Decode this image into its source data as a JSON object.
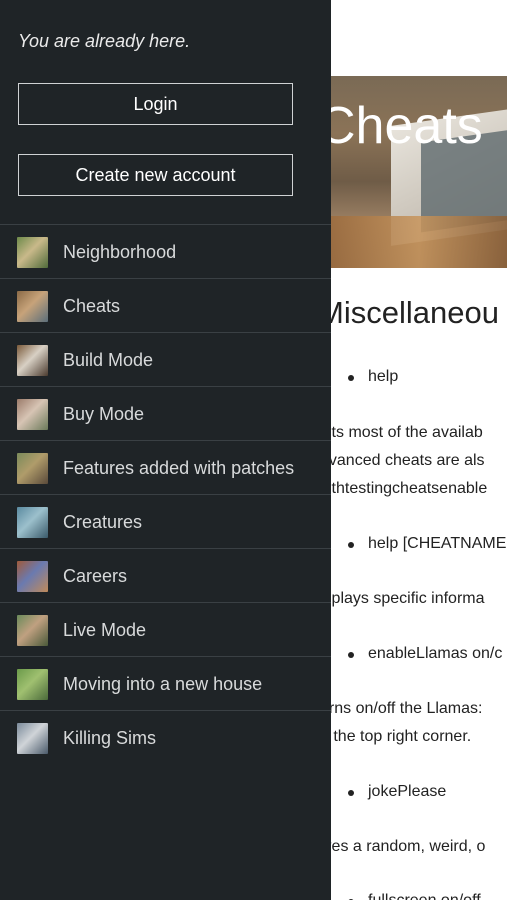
{
  "page": {
    "hero_title": "Cheats",
    "section_heading": "Miscellaneou",
    "bullets": [
      "help",
      "help [CHEATNAME",
      "enableLlamas on/c",
      "jokePlease",
      "fullscreen on/off"
    ],
    "paragraphs": [
      "ists most of the availab",
      "dvanced cheats are als",
      "vithtestingcheatsenable",
      "isplays specific informa",
      "urns on/off the Llamas: ",
      "n the top right corner.",
      "ives a random, weird, o"
    ]
  },
  "drawer": {
    "status_text": "You are already here.",
    "login_label": "Login",
    "create_account_label": "Create new account",
    "menu": [
      {
        "label": "Neighborhood",
        "icon": "neighborhood-thumbnail-icon",
        "colors": [
          "#6d8a4a",
          "#c9b98a",
          "#4f6b3a"
        ]
      },
      {
        "label": "Cheats",
        "icon": "cheats-thumbnail-icon",
        "colors": [
          "#8a6a46",
          "#c7a37a",
          "#5b6e7a"
        ]
      },
      {
        "label": "Build Mode",
        "icon": "build-mode-thumbnail-icon",
        "colors": [
          "#7a5a3a",
          "#d8d0c4",
          "#4a3a2e"
        ]
      },
      {
        "label": "Buy Mode",
        "icon": "buy-mode-thumbnail-icon",
        "colors": [
          "#9b7b6a",
          "#d7c4b4",
          "#6b7a5a"
        ]
      },
      {
        "label": "Features added with patches",
        "icon": "patches-thumbnail-icon",
        "colors": [
          "#7a8a5a",
          "#b09c6a",
          "#5a4a3a"
        ]
      },
      {
        "label": "Creatures",
        "icon": "creatures-thumbnail-icon",
        "colors": [
          "#5a8aa0",
          "#9cc0cc",
          "#3a5a6a"
        ]
      },
      {
        "label": "Careers",
        "icon": "careers-thumbnail-icon",
        "colors": [
          "#a05a3a",
          "#6a7ab0",
          "#c08a5a"
        ]
      },
      {
        "label": "Live Mode",
        "icon": "live-mode-thumbnail-icon",
        "colors": [
          "#6a8a5a",
          "#c0a080",
          "#4a5a3a"
        ]
      },
      {
        "label": "Moving into a new house",
        "icon": "moving-house-thumbnail-icon",
        "colors": [
          "#6a9a4a",
          "#a0c070",
          "#4a6a3a"
        ]
      },
      {
        "label": "Killing Sims",
        "icon": "killing-sims-thumbnail-icon",
        "colors": [
          "#7a8a9a",
          "#d0d4d8",
          "#4a5a6a"
        ]
      }
    ]
  }
}
